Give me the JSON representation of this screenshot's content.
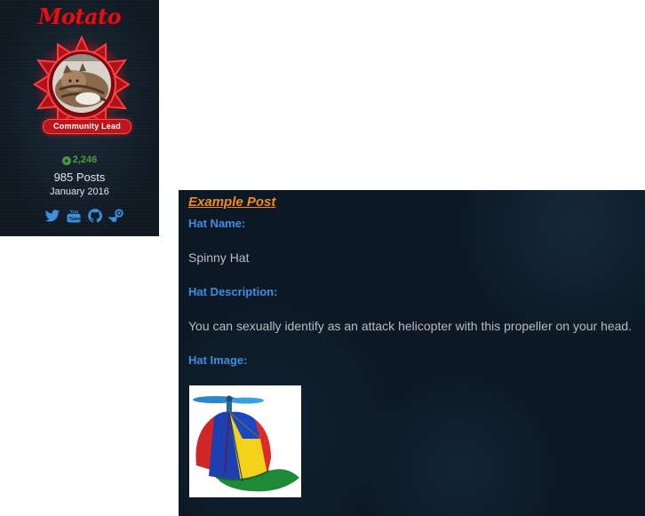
{
  "profile": {
    "username": "Motato",
    "role_badge": "Community Lead",
    "reputation": "2,246",
    "posts": "985 Posts",
    "joined": "January 2016",
    "socials": [
      "twitter-icon",
      "youtube-icon",
      "github-icon",
      "steam-icon"
    ],
    "colors": {
      "username": "#e0101a",
      "badge": "#c0141c",
      "reputation": "#4f9a3c",
      "social": "#3d8fe0"
    }
  },
  "post": {
    "title": "Example Post",
    "hat_name_label": "Hat Name:",
    "hat_name": "Spinny Hat",
    "hat_description_label": "Hat Description:",
    "hat_description": "You can sexually identify as an attack helicopter with this propeller on your head.",
    "hat_image_label": "Hat Image:",
    "colors": {
      "title": "#f28a1e",
      "label": "#3d8fe0",
      "text": "#b8bcc0"
    }
  }
}
